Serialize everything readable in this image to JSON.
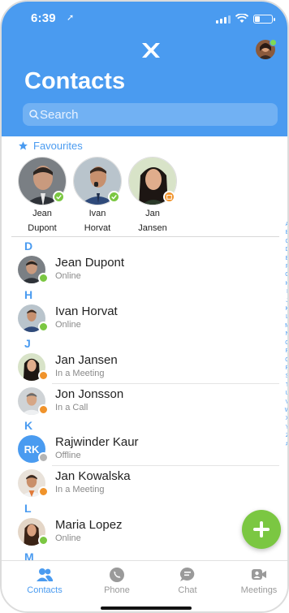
{
  "status_bar": {
    "time": "6:39",
    "location_arrow": "➚"
  },
  "header": {
    "title": "Contacts",
    "search_placeholder": "Search"
  },
  "favourites": {
    "label": "Favourites",
    "items": [
      {
        "first": "Jean",
        "last": "Dupont",
        "status": "online"
      },
      {
        "first": "Ivan",
        "last": "Horvat",
        "status": "online"
      },
      {
        "first": "Jan",
        "last": "Jansen",
        "status": "meeting"
      }
    ]
  },
  "sections": [
    {
      "letter": "D",
      "contacts": [
        {
          "name": "Jean Dupont",
          "status": "Online",
          "badge": "online"
        }
      ]
    },
    {
      "letter": "H",
      "contacts": [
        {
          "name": "Ivan Horvat",
          "status": "Online",
          "badge": "online"
        }
      ]
    },
    {
      "letter": "J",
      "contacts": [
        {
          "name": "Jan Jansen",
          "status": "In a Meeting",
          "badge": "meeting"
        },
        {
          "name": "Jon Jonsson",
          "status": "In a Call",
          "badge": "call"
        }
      ]
    },
    {
      "letter": "K",
      "contacts": [
        {
          "name": "Rajwinder Kaur",
          "status": "Offline",
          "badge": "offline",
          "initials": "RK"
        },
        {
          "name": "Jan Kowalska",
          "status": "In a Meeting",
          "badge": "meeting"
        }
      ]
    },
    {
      "letter": "L",
      "contacts": [
        {
          "name": "Maria Lopez",
          "status": "Online",
          "badge": "online"
        }
      ]
    },
    {
      "letter": "M",
      "contacts": []
    }
  ],
  "alpha_index": [
    "A",
    "B",
    "C",
    "D",
    "E",
    "F",
    "G",
    "H",
    "I",
    "J",
    "K",
    "L",
    "M",
    "N",
    "O",
    "P",
    "Q",
    "R",
    "S",
    "T",
    "U",
    "V",
    "W",
    "X",
    "Y",
    "Z",
    "#"
  ],
  "tabs": [
    {
      "label": "Contacts",
      "icon": "contacts-icon",
      "active": true
    },
    {
      "label": "Phone",
      "icon": "phone-icon"
    },
    {
      "label": "Chat",
      "icon": "chat-icon"
    },
    {
      "label": "Meetings",
      "icon": "meetings-icon"
    }
  ],
  "colors": {
    "accent": "#4a9bf0",
    "online": "#7bc742",
    "meeting": "#f0932b",
    "offline": "#b5b5b5",
    "fab": "#7bc742"
  }
}
